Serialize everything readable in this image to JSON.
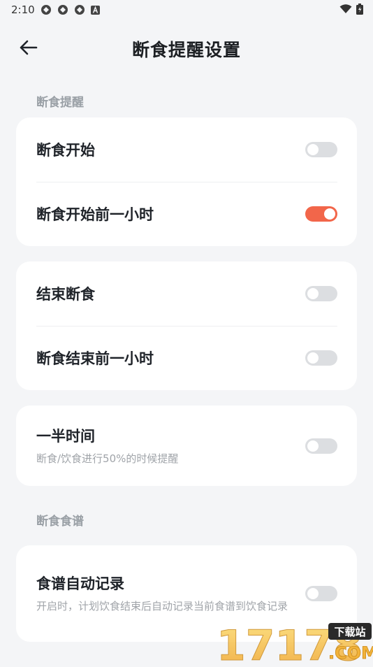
{
  "status_bar": {
    "time": "2:10"
  },
  "header": {
    "title": "断食提醒设置"
  },
  "sections": {
    "reminder_title": "断食提醒",
    "recipe_title": "断食食谱"
  },
  "rows": {
    "fast_start": {
      "label": "断食开始",
      "enabled": false
    },
    "fast_start_before": {
      "label": "断食开始前一小时",
      "enabled": true
    },
    "fast_end": {
      "label": "结束断食",
      "enabled": false
    },
    "fast_end_before": {
      "label": "断食结束前一小时",
      "enabled": false
    },
    "half_time": {
      "label": "一半时间",
      "desc": "断食/饮食进行50%的时候提醒",
      "enabled": false
    },
    "recipe_record": {
      "label": "食谱自动记录",
      "desc": "开启时，计划饮食结束后自动记录当前食谱到饮食记录",
      "enabled": false
    }
  },
  "watermark": {
    "number": "17178",
    "badge": "下载站",
    "domain": ".COM"
  },
  "colors": {
    "accent": "#f2664a",
    "toggle_off": "#dcdee1",
    "background": "#f4f5f7"
  }
}
